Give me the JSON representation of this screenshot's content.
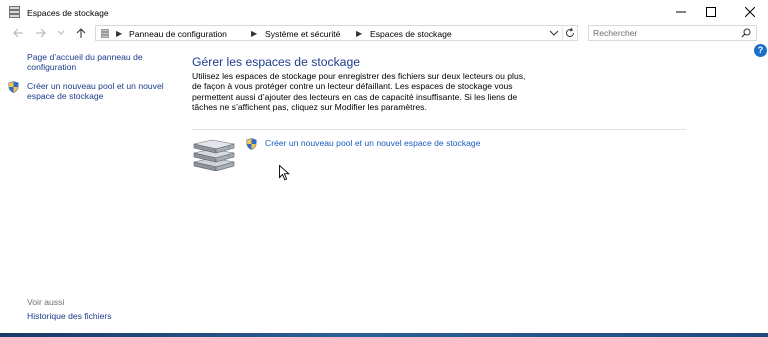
{
  "window": {
    "title": "Espaces de stockage"
  },
  "address": {
    "crumbs": [
      "Panneau de configuration",
      "Système et sécurité",
      "Espaces de stockage"
    ]
  },
  "search": {
    "placeholder": "Rechercher"
  },
  "sidebar": {
    "home_link": "Page d’accueil du panneau de configuration",
    "create_link": "Créer un nouveau pool et un nouvel espace de stockage",
    "see_also": "Voir aussi",
    "history_link": "Historique des fichiers"
  },
  "main": {
    "heading": "Gérer les espaces de stockage",
    "description": "Utilisez les espaces de stockage pour enregistrer des fichiers sur deux lecteurs ou plus, de façon à vous protéger contre un lecteur défaillant. Les espaces de stockage vous permettent aussi d’ajouter des lecteurs en cas de capacité insuffisante. Si les liens de tâches ne s’affichent pas, cliquez sur Modifier les paramètres.",
    "task_link": "Créer un nouveau pool et un nouvel espace de stockage"
  },
  "help": {
    "label": "?"
  },
  "colors": {
    "link": "#1a5bbf",
    "heading": "#1e3d8f",
    "taskbar": "#1b3f6e"
  }
}
